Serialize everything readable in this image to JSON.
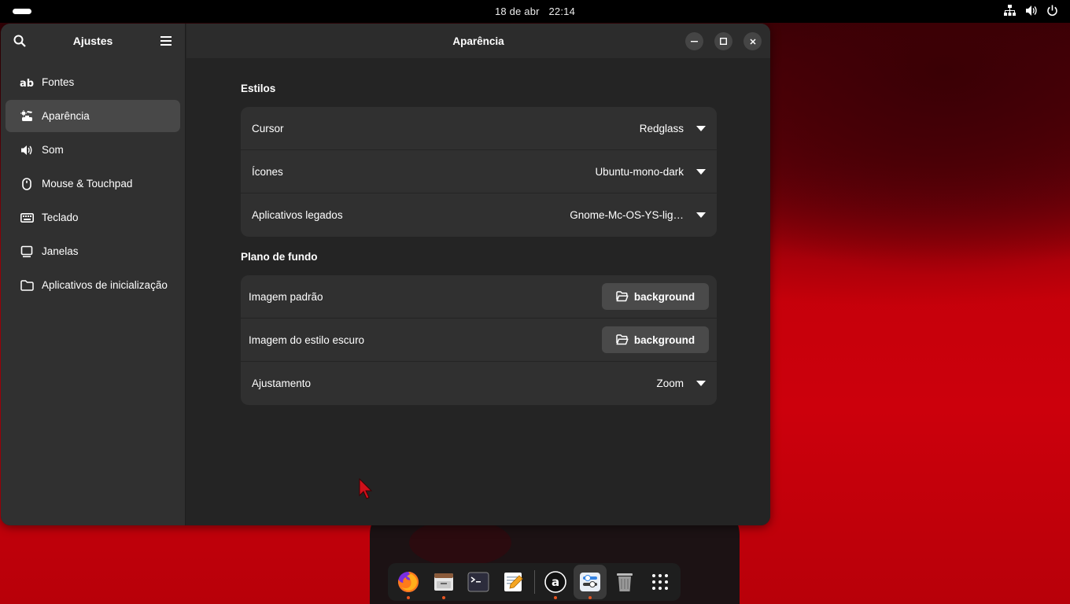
{
  "topbar": {
    "date": "18 de abr",
    "time": "22:14",
    "tray_icons": [
      "network-icon",
      "volume-icon",
      "power-icon"
    ]
  },
  "sidebar": {
    "title": "Ajustes",
    "items": [
      {
        "label": "Fontes",
        "icon": "fonts-icon"
      },
      {
        "label": "Aparência",
        "icon": "appearance-icon",
        "active": true
      },
      {
        "label": "Som",
        "icon": "sound-icon"
      },
      {
        "label": "Mouse & Touchpad",
        "icon": "mouse-icon"
      },
      {
        "label": "Teclado",
        "icon": "keyboard-icon"
      },
      {
        "label": "Janelas",
        "icon": "window-icon"
      },
      {
        "label": "Aplicativos de inicialização",
        "icon": "folder-icon"
      }
    ]
  },
  "main": {
    "title": "Aparência",
    "styles_section": {
      "title": "Estilos",
      "rows": [
        {
          "label": "Cursor",
          "value": "Redglass"
        },
        {
          "label": "Ícones",
          "value": "Ubuntu-mono-dark"
        },
        {
          "label": "Aplicativos legados",
          "value": "Gnome-Mc-OS-YS-lig…"
        }
      ]
    },
    "background_section": {
      "title": "Plano de fundo",
      "default_image": {
        "label": "Imagem padrão",
        "button": "background"
      },
      "dark_image": {
        "label": "Imagem do estilo escuro",
        "button": "background"
      },
      "adjustment": {
        "label": "Ajustamento",
        "value": "Zoom"
      }
    }
  },
  "dock": {
    "apps": [
      "firefox-icon",
      "files-icon",
      "terminal-icon",
      "text-editor-icon",
      "amazon-icon",
      "tweaks-icon",
      "trash-icon",
      "app-grid-icon"
    ]
  },
  "colors": {
    "accent": "#e95420",
    "window_bg": "#242424",
    "sidebar_bg": "#303030"
  }
}
